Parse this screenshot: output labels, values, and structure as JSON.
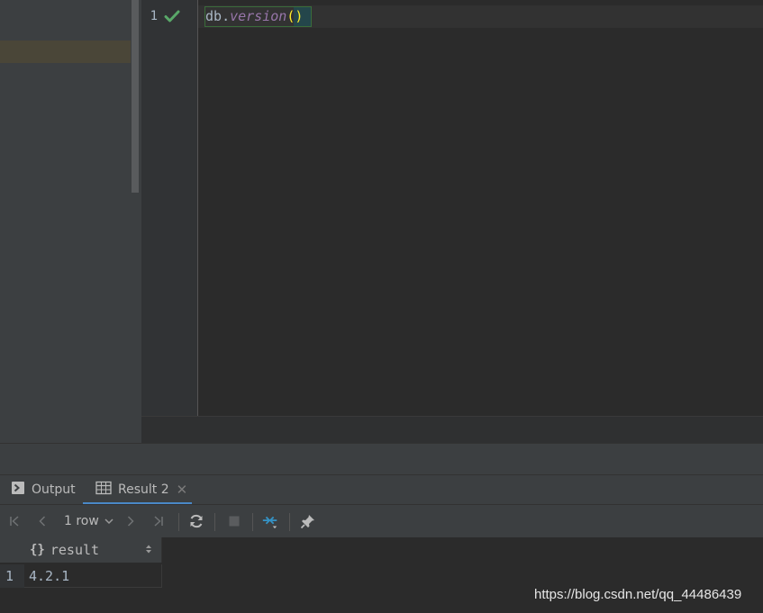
{
  "editor": {
    "line_number": "1",
    "code": {
      "object": "db",
      "dot": ".",
      "method": "version",
      "parens": "()"
    }
  },
  "tabs": [
    {
      "label": "Output",
      "icon": "console-icon"
    },
    {
      "label": "Result 2",
      "icon": "table-icon",
      "closable": true,
      "active": true
    }
  ],
  "toolbar": {
    "page_size": "1 row",
    "buttons": [
      "first-page-icon",
      "prev-page-icon",
      "next-page-icon",
      "last-page-icon",
      "refresh-icon",
      "stop-icon",
      "compare-icon",
      "pin-icon"
    ]
  },
  "grid": {
    "column": {
      "icon": "{}",
      "name": "result"
    },
    "rows": [
      {
        "number": "1",
        "value": "4.2.1"
      }
    ]
  },
  "watermark": "https://blog.csdn.net/qq_44486439",
  "colors": {
    "accent": "#4a88c7",
    "check": "#59a869",
    "background": "#2b2b2b"
  }
}
